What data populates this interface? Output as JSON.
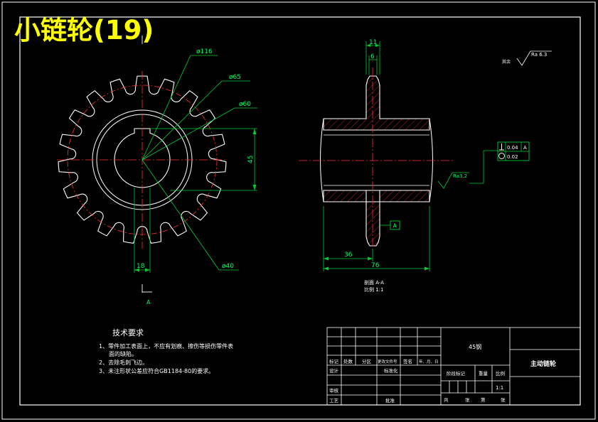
{
  "title": "小链轮(19)",
  "colors": {
    "background": "#000000",
    "lines": "#ffffff",
    "dimensions": "#00ff00",
    "centerlines": "#ff3030",
    "title": "#ffff00"
  },
  "dimensions": {
    "d116": "ø116",
    "d65": "ø65",
    "d60": "ø60",
    "d40": "ø40",
    "w45": "45",
    "w18": "18",
    "t11": "11",
    "t6": "6",
    "l36": "36",
    "l76": "76",
    "section_letter": "A"
  },
  "section": {
    "label": "剖面 A-A",
    "scale": "比例 1:1"
  },
  "roughness": {
    "rest_label": "其余",
    "value": "Ra 6.3",
    "local_value": "Ra3.2"
  },
  "tolerance": {
    "row1_value": "0.04",
    "row1_datum": "A",
    "row2_value": "0.02",
    "datum": "A"
  },
  "requirements": {
    "heading": "技术要求",
    "items": [
      "1、零件加工表面上，不应有划痕、擦伤等损伤零件表",
      "面的缺陷。",
      "2、去除毛刺飞边。",
      "3、未注形状公差应符合GB1184-80的要求。"
    ]
  },
  "title_block": {
    "material": "45钢",
    "part_name": "主动链轮",
    "scale": "1:1",
    "labels": {
      "mark": "标记",
      "count": "处数",
      "zone": "分区",
      "change_doc": "更改文件号",
      "sign": "签名",
      "date": "年、月、日",
      "design": "设计",
      "standardize": "标准化",
      "stage_mark": "阶段标记",
      "weight": "重量",
      "ratio": "比例",
      "review": "审核",
      "process": "工艺",
      "approve": "批准",
      "total": "共",
      "sheets": "张",
      "no": "第",
      "sheet": "张"
    }
  }
}
